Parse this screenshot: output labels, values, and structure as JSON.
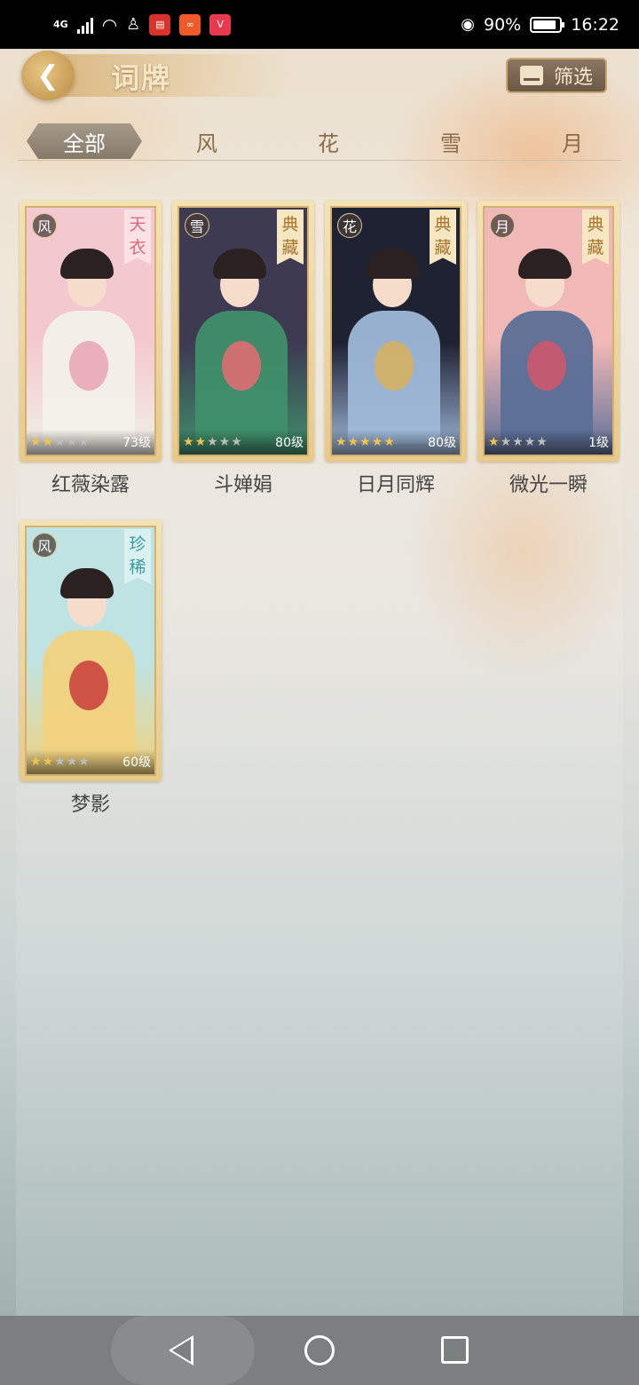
{
  "status_bar": {
    "network": "4G",
    "battery": "90%",
    "battery_level": 0.9,
    "time": "16:22",
    "app_badge_icons": [
      "news-app-icon",
      "album-app-icon",
      "video-app-icon"
    ]
  },
  "header": {
    "title": "词牌",
    "filter_label": "筛选"
  },
  "tabs": [
    "全部",
    "风",
    "花",
    "雪",
    "月"
  ],
  "active_tab": "全部",
  "cards": [
    {
      "name": "红薇染露",
      "element": "风",
      "rarity": [
        "天",
        "衣"
      ],
      "stars": 2,
      "level": "73级",
      "palette": {
        "bg": "#f3c9cf",
        "robe": "#f2f0e8",
        "accent": "#e7a3b5",
        "tag_bg": "#fbe0e4",
        "tag_fg": "#d96a7b"
      }
    },
    {
      "name": "斗婵娟",
      "element": "雪",
      "rarity": [
        "典",
        "藏"
      ],
      "stars": 2,
      "level": "80级",
      "palette": {
        "bg": "#3e3a52",
        "robe": "#3f8f6a",
        "accent": "#e86a73",
        "tag_bg": "#f6e6c2",
        "tag_fg": "#a8742e"
      }
    },
    {
      "name": "日月同辉",
      "element": "花",
      "rarity": [
        "典",
        "藏"
      ],
      "stars": 5,
      "level": "80级",
      "palette": {
        "bg": "#1f2233",
        "robe": "#9fb8d8",
        "accent": "#d7b25c",
        "tag_bg": "#f6e6c2",
        "tag_fg": "#a8742e"
      }
    },
    {
      "name": "微光一瞬",
      "element": "月",
      "rarity": [
        "典",
        "藏"
      ],
      "stars": 1,
      "level": "1级",
      "palette": {
        "bg": "#f0b8b6",
        "robe": "#5b6f97",
        "accent": "#d4566a",
        "tag_bg": "#f6e6c2",
        "tag_fg": "#a8742e"
      }
    },
    {
      "name": "梦影",
      "element": "风",
      "rarity": [
        "珍",
        "稀"
      ],
      "stars": 2,
      "level": "60级",
      "palette": {
        "bg": "#bfe3e2",
        "robe": "#f1d27e",
        "accent": "#c93c3c",
        "tag_bg": "#d9f1f0",
        "tag_fg": "#3b9ba0"
      }
    }
  ]
}
